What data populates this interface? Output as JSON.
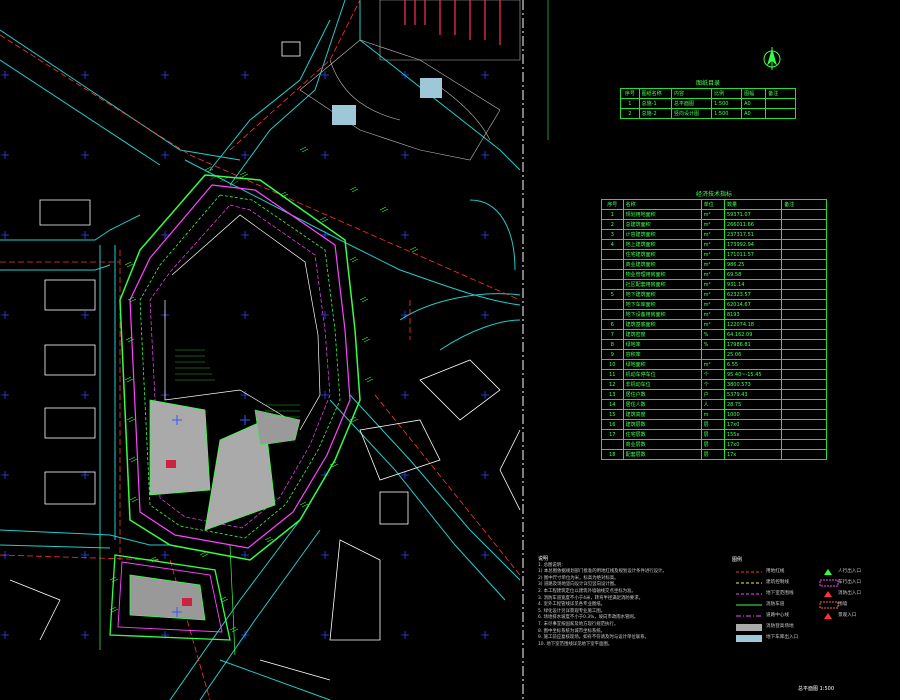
{
  "drawing_index": {
    "title": "图纸目录",
    "headers": [
      "序号",
      "图纸名称",
      "内容",
      "比例",
      "图幅",
      "备注"
    ],
    "rows": [
      [
        "1",
        "总施-1",
        "总平面图",
        "1:500",
        "A0",
        ""
      ],
      [
        "2",
        "总施-2",
        "竖向设计图",
        "1:500",
        "A0",
        ""
      ]
    ]
  },
  "tech_table": {
    "title": "经济技术指标",
    "headers": [
      "序号",
      "名称",
      "单位",
      "数量",
      "备注"
    ],
    "rows": [
      [
        "1",
        "规划用地面积",
        "m²",
        "59371.07",
        ""
      ],
      [
        "2",
        "总建筑面积",
        "m²",
        "266011.66",
        ""
      ],
      [
        "3",
        "计容建筑面积",
        "m²",
        "237317.51",
        ""
      ],
      [
        "4",
        "地上建筑面积",
        "m²",
        "173992.94",
        ""
      ],
      [
        "",
        "住宅建筑面积",
        "m²",
        "171011.57",
        ""
      ],
      [
        "",
        "商业建筑面积",
        "m²",
        "986.25",
        ""
      ],
      [
        "",
        "物业管理用房面积",
        "m²",
        "69.58",
        ""
      ],
      [
        "",
        "社区配套用房面积",
        "m²",
        "931.14",
        ""
      ],
      [
        "5",
        "地下建筑面积",
        "m²",
        "62323.57",
        ""
      ],
      [
        "",
        "地下车库面积",
        "m²",
        "62014.67",
        ""
      ],
      [
        "",
        "地下设备用房面积",
        "m²",
        "8193",
        ""
      ],
      [
        "6",
        "建筑基底面积",
        "m²",
        "122074.18",
        ""
      ],
      [
        "7",
        "建筑密度",
        "%",
        "64.162.09",
        ""
      ],
      [
        "8",
        "绿地率",
        "%",
        "17986.81",
        ""
      ],
      [
        "9",
        "容积率",
        "",
        "25.06",
        ""
      ],
      [
        "10",
        "绿地面积",
        "m²",
        "6.55",
        ""
      ],
      [
        "11",
        "机动车停车位",
        "个",
        "95.40~-15.45",
        ""
      ],
      [
        "12",
        "非机动车位",
        "个",
        "3800.573",
        ""
      ],
      [
        "13",
        "居住户数",
        "户",
        "5379.43",
        ""
      ],
      [
        "14",
        "居住人数",
        "人",
        "28.75",
        ""
      ],
      [
        "15",
        "建筑高度",
        "m",
        "1000",
        ""
      ],
      [
        "16",
        "建筑层数",
        "层",
        "17ⅹ0",
        ""
      ],
      [
        "17",
        "住宅层数",
        "层",
        "155ⅹ",
        ""
      ],
      [
        "",
        "商业层数",
        "层",
        "17ⅹ0",
        ""
      ],
      [
        "18",
        "配套层数",
        "层",
        "17ⅹ",
        ""
      ]
    ]
  },
  "notes": {
    "heading": "说明",
    "lines": [
      "1. 总图说明：",
      "1) 本总图依据规划部门批准的用地红线及规划设计条件进行设计。",
      "2) 图中尺寸单位为米，标高为绝对标高。",
      "3) 道路及场地竖向设计详见竖向设计图。",
      "2. 本工程建筑定位以建筑外墙轴线交点坐标为准。",
      "3. 消防车道宽度不小于4米，转弯半径满足消防要求。",
      "4. 室外工程管线详见各专业图纸。",
      "5. 绿化设计另详景观专业施工图。",
      "6. 场地排水坡度不小于0.3%，坡向市政雨水管网。",
      "7. 未尽事宜按国家及地方现行规范执行。",
      "8. 图中坐标系统为城市坐标系统。",
      "9. 施工前应复核现场，如有不符请及时与设计单位联系。",
      "10. 地下室范围线详见地下室平面图。"
    ]
  },
  "legend": {
    "heading": "图例",
    "items": [
      {
        "label": "用地红线",
        "color": "#ff3333",
        "style": "dash"
      },
      {
        "label": "建筑控制线",
        "color": "#ffee33",
        "style": "dash"
      },
      {
        "label": "地下室范围线",
        "color": "#ff44ff",
        "style": "dash"
      },
      {
        "label": "消防车道",
        "color": "#33ff44",
        "style": "solid"
      },
      {
        "label": "道路中心线",
        "color": "#ff44ff",
        "style": "dashdot"
      },
      {
        "label": "消防登高场地",
        "color": "#aaaaaa",
        "style": "fill"
      },
      {
        "label": "地下车库出入口",
        "color": "#9ec8d8",
        "style": "fill"
      },
      {
        "label": "人行出入口",
        "color": "#33ff44",
        "style": "icon"
      },
      {
        "label": "车行出入口",
        "color": "#ff44ff",
        "style": "box"
      },
      {
        "label": "消防出入口",
        "color": "#ff3333",
        "style": "arrow"
      },
      {
        "label": "围墙",
        "color": "#ff6633",
        "style": "box"
      },
      {
        "label": "景观入口",
        "color": "#ff3333",
        "style": "icon"
      }
    ]
  },
  "scale_label": "总平面图 1:500",
  "colors": {
    "background": "#000000",
    "grid": "#3344ff",
    "road": "#22cccc",
    "site": "#33ff44",
    "boundary": "#ff3333",
    "basement": "#ff44ff",
    "building": "#ffffff",
    "plaza": "#aaaaaa"
  },
  "north_arrow_icon": "north-arrow-icon"
}
